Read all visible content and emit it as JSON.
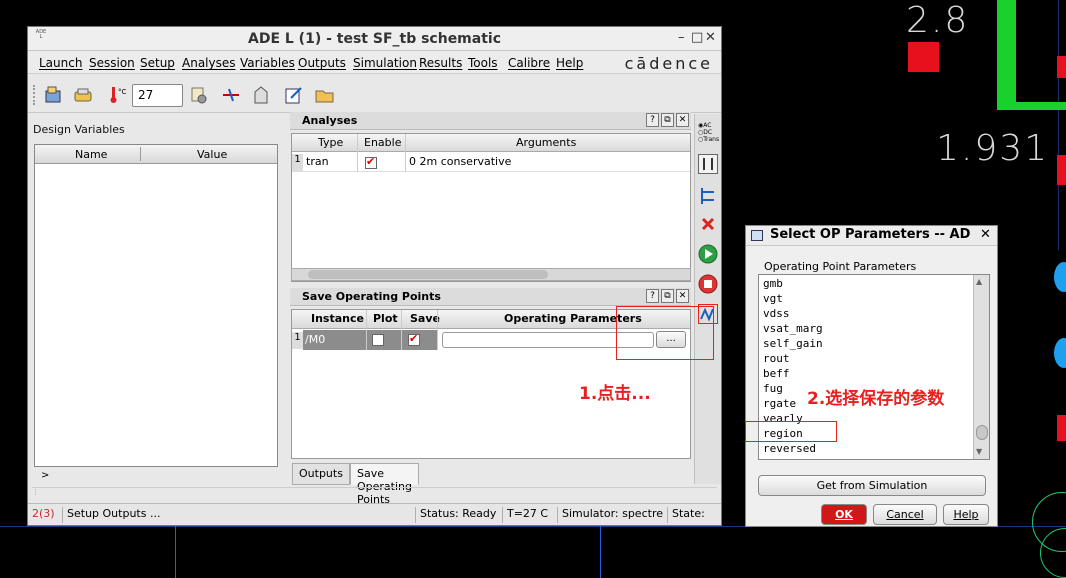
{
  "background": {
    "value_top": "2.8",
    "value_mid": "1.931"
  },
  "ade": {
    "window_title": "ADE L (1) - test SF_tb schematic",
    "app_icon_text": "ADE L",
    "window_controls": {
      "minimize": "–",
      "maximize": "□",
      "close": "✕"
    },
    "menus": [
      "Launch",
      "Session",
      "Setup",
      "Analyses",
      "Variables",
      "Outputs",
      "Simulation",
      "Results",
      "Tools",
      "Calibre",
      "Help"
    ],
    "brand": "cādence",
    "toolbar": {
      "temperature_unit": "°C",
      "temperature_value": "27"
    },
    "design_variables": {
      "label": "Design Variables",
      "columns": [
        "Name",
        "Value"
      ]
    },
    "analyses": {
      "title": "Analyses",
      "panel_buttons": [
        "?",
        "⧉",
        "✕"
      ],
      "columns": [
        "Type",
        "Enable",
        "Arguments"
      ],
      "rows": [
        {
          "num": "1",
          "type": "tran",
          "enabled": true,
          "arguments": "0 2m conservative"
        }
      ]
    },
    "save_op": {
      "title": "Save Operating Points",
      "panel_buttons": [
        "?",
        "⧉",
        "✕"
      ],
      "columns": [
        "Instance",
        "Plot",
        "Save",
        "Operating Parameters"
      ],
      "rows": [
        {
          "num": "1",
          "instance": "/M0",
          "plot": false,
          "save": true,
          "parameters": "",
          "browse_label": "..."
        }
      ]
    },
    "right_bar": {
      "ac": "AC",
      "dc": "DC",
      "trans": "Trans"
    },
    "tabs": [
      "Outputs",
      "Save Operating Points"
    ],
    "status": {
      "item": "2(3)",
      "message": "Setup Outputs ...",
      "status": "Status: Ready",
      "temp": "T=27  C",
      "simulator": "Simulator: spectre",
      "state": "State:"
    },
    "misc": {
      "gutter": ">"
    }
  },
  "op_dialog": {
    "title": "Select OP Parameters -- AD",
    "close": "✕",
    "list_label": "Operating Point Parameters",
    "items": [
      "gmb",
      "vgt",
      "vdss",
      "vsat_marg",
      "self_gain",
      "rout",
      "beff",
      "fug",
      "rgate",
      "vearly",
      "region",
      "reversed"
    ],
    "buttons": {
      "get": "Get from Simulation",
      "ok": "OK",
      "cancel": "Cancel",
      "help": "Help"
    }
  },
  "annotations": {
    "step1": "1.点击...",
    "step2": "2.选择保存的参数"
  },
  "colors": {
    "annotation": "#e82020",
    "schematic_red": "#e8101c",
    "schematic_green": "#18d12c",
    "wire_blue": "#2a5ed8",
    "ok_button": "#d01818"
  }
}
